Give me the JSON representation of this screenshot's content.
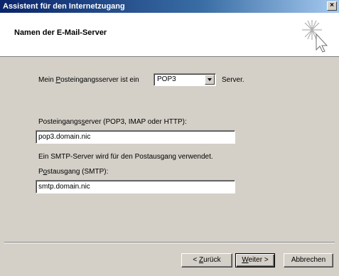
{
  "window": {
    "title": "Assistent für den Internetzugang",
    "close_glyph": "×"
  },
  "header": {
    "title": "Namen der E-Mail-Server",
    "icon": "wizard-sparkle-cursor-icon"
  },
  "incoming_type": {
    "label_prefix": "Mein ",
    "label_accel": "P",
    "label_rest": "osteingangsserver ist ein",
    "selected": "POP3",
    "suffix": "Server."
  },
  "incoming_server": {
    "label_prefix": "Posteingangs",
    "label_accel": "s",
    "label_rest": "erver (POP3, IMAP oder HTTP):",
    "value": "pop3.domain.nic"
  },
  "smtp_info": {
    "text": "Ein SMTP-Server wird für den Postausgang verwendet."
  },
  "outgoing_server": {
    "label_prefix": "P",
    "label_accel": "o",
    "label_rest": "stausgang (SMTP):",
    "value": "smtp.domain.nic"
  },
  "buttons": {
    "back_prefix": "< ",
    "back_accel": "Z",
    "back_rest": "urück",
    "next_accel": "W",
    "next_rest": "eiter >",
    "cancel": "Abbrechen"
  },
  "colors": {
    "title_bar_start": "#0a246a",
    "title_bar_end": "#a6caf0",
    "dialog_bg": "#d4d0c8",
    "header_bg": "#ffffff"
  }
}
